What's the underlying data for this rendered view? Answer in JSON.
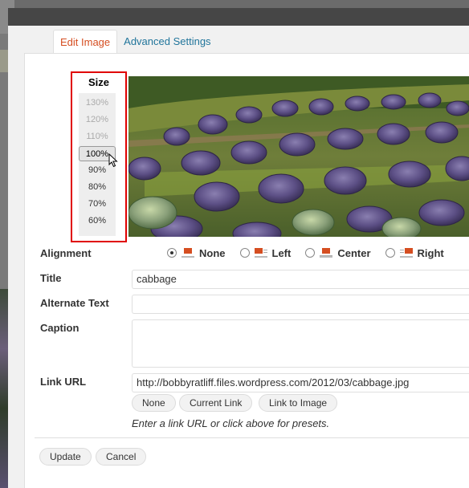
{
  "tabs": [
    {
      "label": "Edit Image"
    },
    {
      "label": "Advanced Settings"
    }
  ],
  "size": {
    "title": "Size",
    "options": [
      "130%",
      "120%",
      "110%",
      "100%",
      "90%",
      "80%",
      "70%",
      "60%"
    ],
    "selected": "100%"
  },
  "alignment": {
    "label": "Alignment",
    "options": [
      "None",
      "Left",
      "Center",
      "Right"
    ],
    "selected": "None"
  },
  "title_field": {
    "label": "Title",
    "value": "cabbage"
  },
  "alt_field": {
    "label": "Alternate Text",
    "value": ""
  },
  "caption_field": {
    "label": "Caption",
    "value": ""
  },
  "link": {
    "label": "Link URL",
    "value": "http://bobbyratliff.files.wordpress.com/2012/03/cabbage.jpg",
    "buttons": [
      "None",
      "Current Link",
      "Link to Image"
    ],
    "hint": "Enter a link URL or click above for presets."
  },
  "actions": {
    "update": "Update",
    "cancel": "Cancel"
  },
  "colors": {
    "accent": "#d54e21",
    "link": "#21759b",
    "highlight": "#e00000"
  },
  "icons": {
    "cursor": "mouse-pointer-icon",
    "align": "image-align-icon"
  }
}
